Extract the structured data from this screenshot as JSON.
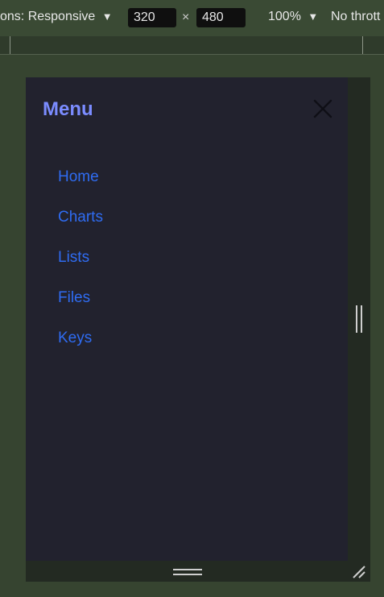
{
  "toolbar": {
    "dimensions_label": "ons: Responsive",
    "dimensions_arrow": "▼",
    "width_value": "320",
    "times": "×",
    "height_value": "480",
    "zoom_label": "100%",
    "zoom_arrow": "▼",
    "throttle_label": "No thrott"
  },
  "menu": {
    "title": "Menu",
    "close_icon": "close-icon",
    "items": [
      {
        "label": "Home"
      },
      {
        "label": "Charts"
      },
      {
        "label": "Lists"
      },
      {
        "label": "Files"
      },
      {
        "label": "Keys"
      }
    ]
  },
  "colors": {
    "menu_title": "#7b8cff",
    "nav_link": "#2f6cf2",
    "panel_bg": "#22222e",
    "backdrop": "#364430"
  }
}
